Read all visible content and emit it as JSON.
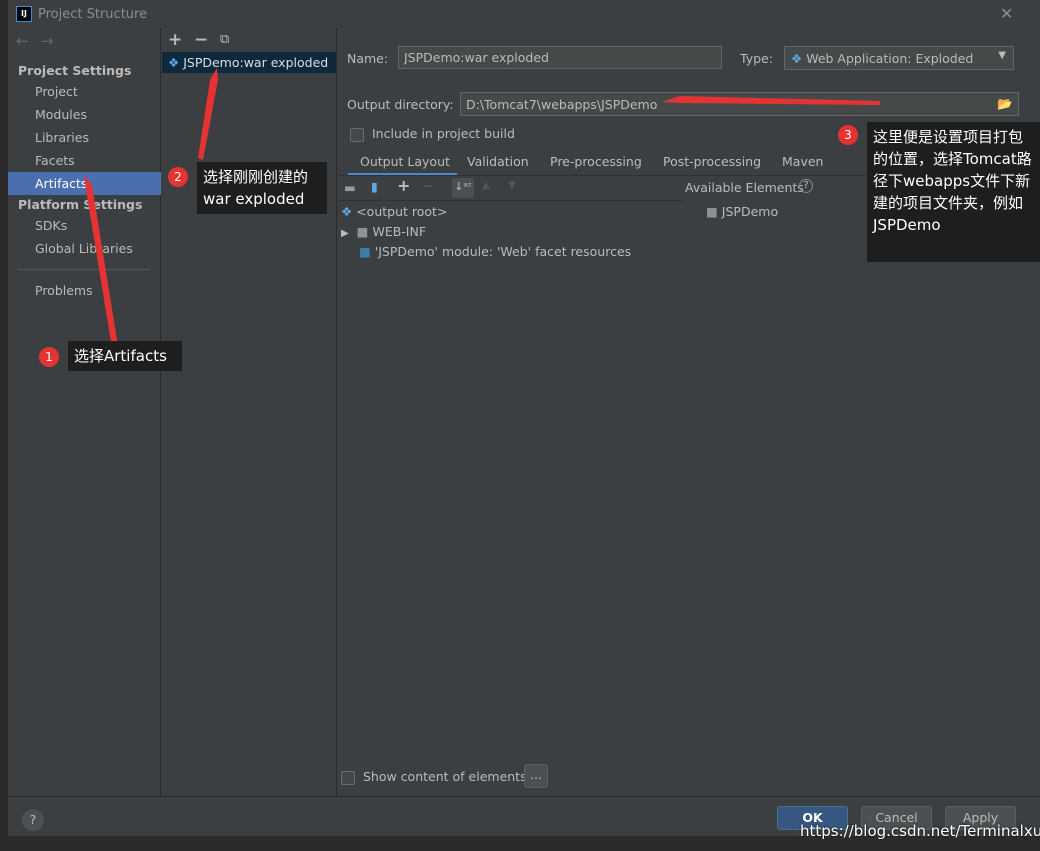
{
  "window": {
    "title": "Project Structure"
  },
  "sidebar": {
    "section1": "Project Settings",
    "items1": [
      "Project",
      "Modules",
      "Libraries",
      "Facets",
      "Artifacts"
    ],
    "section2": "Platform Settings",
    "items2": [
      "SDKs",
      "Global Libraries"
    ],
    "problems": "Problems",
    "selected": "Artifacts"
  },
  "artifacts": {
    "items": [
      "JSPDemo:war exploded"
    ]
  },
  "main": {
    "name_label": "Name:",
    "name_value": "JSPDemo:war exploded",
    "type_label": "Type:",
    "type_value": "Web Application: Exploded",
    "output_label": "Output directory:",
    "output_value": "D:\\Tomcat7\\webapps\\JSPDemo",
    "include_label": "Include in project build",
    "tabs": [
      "Output Layout",
      "Validation",
      "Pre-processing",
      "Post-processing",
      "Maven"
    ],
    "active_tab": "Output Layout",
    "available_label": "Available Elements",
    "tree": [
      "<output root>",
      "WEB-INF",
      "'JSPDemo' module: 'Web' facet resources"
    ],
    "available": [
      "JSPDemo"
    ],
    "show_content_label": "Show content of elements",
    "more_label": "..."
  },
  "footer": {
    "help": "?",
    "ok": "OK",
    "cancel": "Cancel",
    "apply": "Apply"
  },
  "annotations": [
    {
      "num": "1",
      "text": "选择Artifacts"
    },
    {
      "num": "2",
      "text": "选择刚刚创建的war exploded"
    },
    {
      "num": "3",
      "text": "这里便是设置项目打包的位置，选择Tomcat路径下webapps文件下新建的项目文件夹，例如JSPDemo"
    }
  ],
  "watermark": "https://blog.csdn.net/Terminalxun",
  "colors": {
    "accent": "#4b6eaf",
    "annotation": "#e53333"
  }
}
